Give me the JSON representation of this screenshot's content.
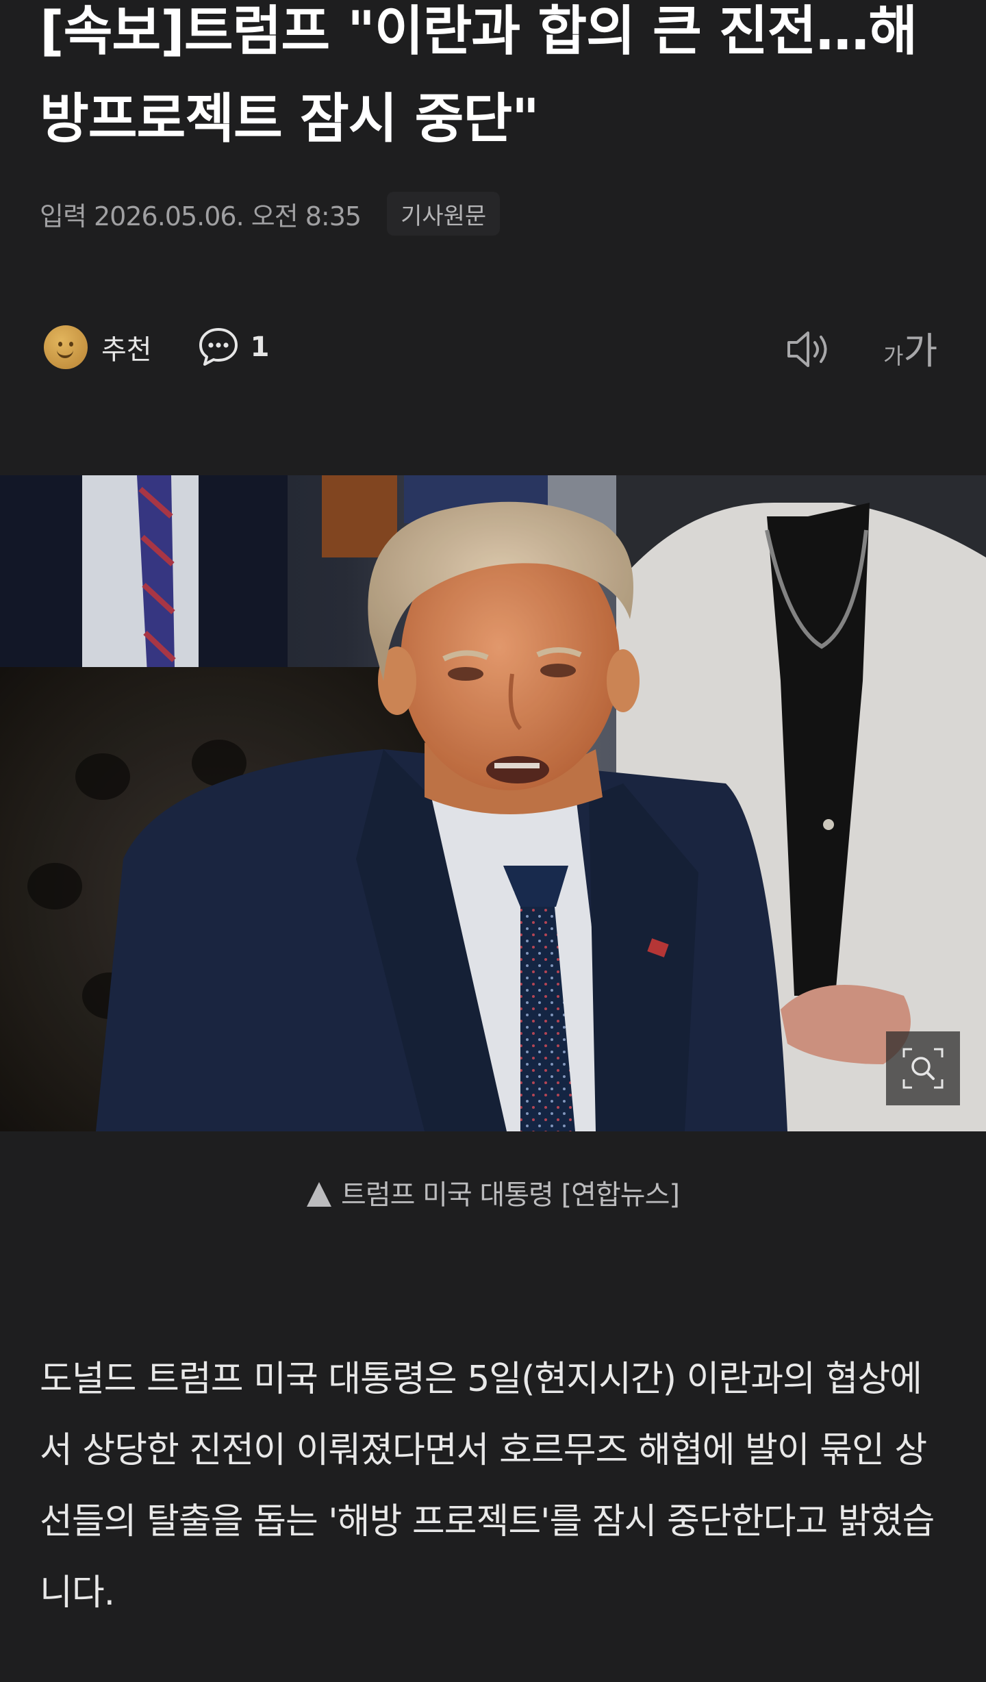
{
  "article": {
    "headline": "[속보]트럼프 \"이란과 합의 큰 진전…해\n방프로젝트 잠시 중단\"",
    "meta": {
      "published": "입력 2026.05.06. 오전 8:35",
      "source_button": "기사원문"
    },
    "actions": {
      "like_label": "추천",
      "comment_count": "1",
      "fontsize_small": "가",
      "fontsize_big": "가"
    },
    "image": {
      "caption": "트럼프 미국 대통령 [연합뉴스]"
    },
    "body": "도널드 트럼프 미국 대통령은 5일(현지시간) 이란과의 협상에서 상당한 진전이 이뤄졌다면서 호르무즈 해협에 발이 묶인 상선들의 탈출을 돕는 '해방 프로젝트'를 잠시 중단한다고 밝혔습니다."
  },
  "icons": {
    "like": "smile-emoji-icon",
    "comment": "speech-bubble-icon",
    "listen": "speaker-icon",
    "zoom": "zoom-magnifier-icon"
  },
  "colors": {
    "background": "#1e1e1f",
    "headline": "#ffffff",
    "meta": "#a0a0a2",
    "body_text": "#e8e8e8",
    "caption": "#bcbcbe"
  }
}
